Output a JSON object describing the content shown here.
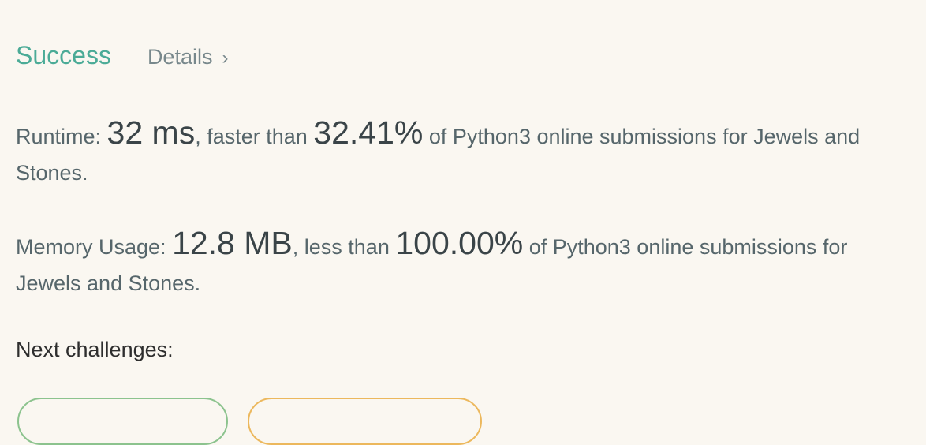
{
  "status": {
    "label": "Success",
    "details_label": "Details",
    "color": "#4bab97"
  },
  "runtime": {
    "prefix": "Runtime: ",
    "value": "32 ms",
    "middle": ", faster than ",
    "percent": "32.41%",
    "suffix": " of Python3 online submissions for Jewels and Stones."
  },
  "memory": {
    "prefix": "Memory Usage: ",
    "value": "12.8 MB",
    "middle": ", less than ",
    "percent": "100.00%",
    "suffix": " of Python3 online submissions for Jewels and Stones."
  },
  "next": {
    "heading": "Next challenges:",
    "pill_colors": [
      "#8cc38e",
      "#ecb85d"
    ]
  }
}
